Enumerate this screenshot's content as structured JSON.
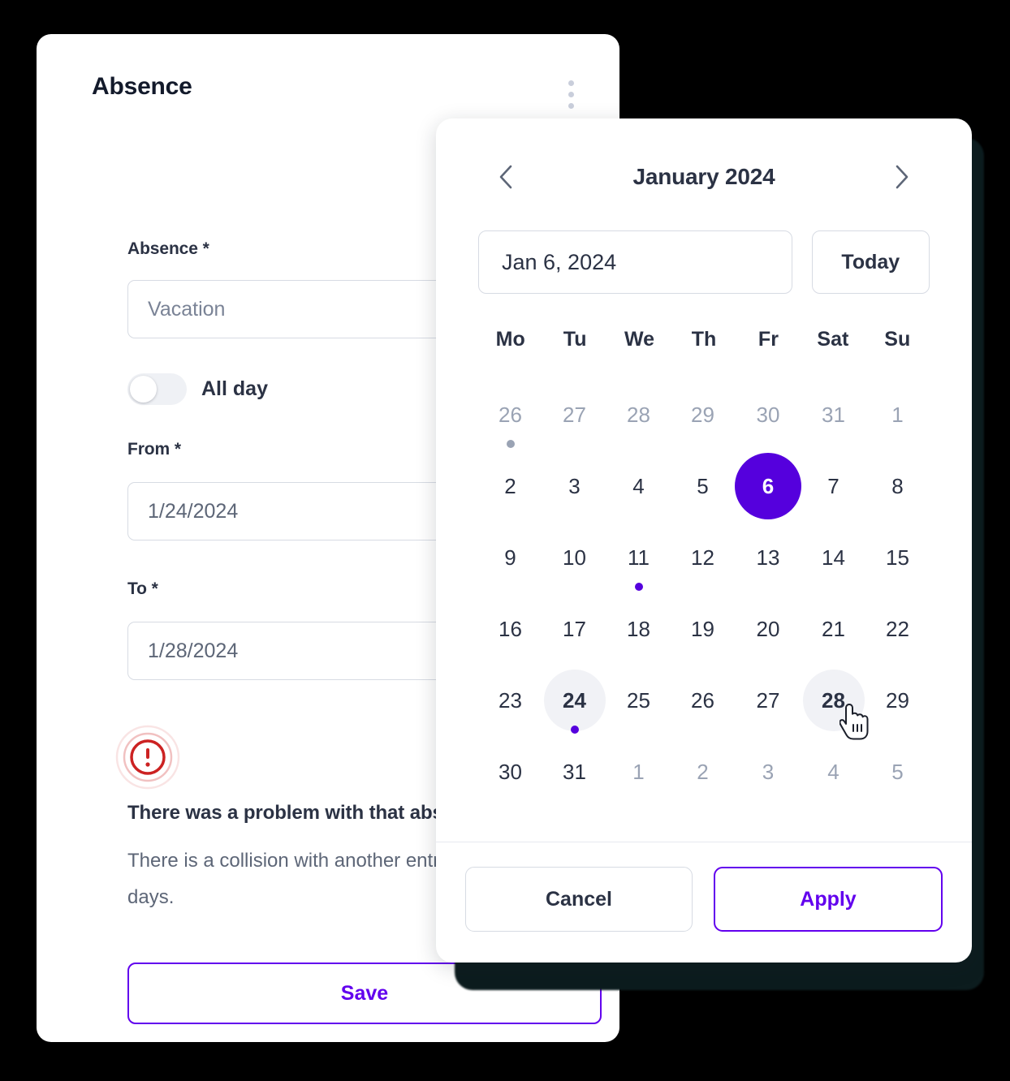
{
  "form": {
    "title": "Absence",
    "menu_icon": "kebab-menu-icon",
    "fields": {
      "absence": {
        "label": "Absence *",
        "value": "Vacation",
        "placeholder": "Vacation"
      },
      "all_day": {
        "label": "All day",
        "enabled": false
      },
      "from": {
        "label": "From *",
        "value": "1/24/2024",
        "placeholder": "1/24/2024"
      },
      "to": {
        "label": "To *",
        "value": "1/28/2024",
        "placeholder": "1/28/2024"
      }
    },
    "error": {
      "icon": "error-circle-icon",
      "title": "There was a problem with that absence",
      "body": "There is a collision with another entry on one of the days.",
      "color": "#cc2222"
    },
    "save_label": "Save"
  },
  "calendar": {
    "prev_icon": "chevron-left-icon",
    "next_icon": "chevron-right-icon",
    "month_label": "January 2024",
    "date_value": "Jan 6, 2024",
    "today_label": "Today",
    "weekdays": [
      "Mo",
      "Tu",
      "We",
      "Th",
      "Fr",
      "Sat",
      "Su"
    ],
    "accent_color": "#5500dd",
    "days": [
      {
        "n": "26",
        "muted": true,
        "dot": "gray"
      },
      {
        "n": "27",
        "muted": true
      },
      {
        "n": "28",
        "muted": true
      },
      {
        "n": "29",
        "muted": true
      },
      {
        "n": "30",
        "muted": true
      },
      {
        "n": "31",
        "muted": true
      },
      {
        "n": "1",
        "muted": true
      },
      {
        "n": "2"
      },
      {
        "n": "3"
      },
      {
        "n": "4"
      },
      {
        "n": "5"
      },
      {
        "n": "6",
        "selected": true
      },
      {
        "n": "7"
      },
      {
        "n": "8"
      },
      {
        "n": "9"
      },
      {
        "n": "10"
      },
      {
        "n": "11",
        "dot": "purple"
      },
      {
        "n": "12"
      },
      {
        "n": "13"
      },
      {
        "n": "14"
      },
      {
        "n": "15"
      },
      {
        "n": "16"
      },
      {
        "n": "17"
      },
      {
        "n": "18"
      },
      {
        "n": "19"
      },
      {
        "n": "20"
      },
      {
        "n": "21"
      },
      {
        "n": "22"
      },
      {
        "n": "23"
      },
      {
        "n": "24",
        "highlight": true,
        "dot": "purple"
      },
      {
        "n": "25"
      },
      {
        "n": "26"
      },
      {
        "n": "27"
      },
      {
        "n": "28",
        "highlight": true
      },
      {
        "n": "29"
      },
      {
        "n": "30"
      },
      {
        "n": "31"
      },
      {
        "n": "1",
        "muted": true
      },
      {
        "n": "2",
        "muted": true
      },
      {
        "n": "3",
        "muted": true
      },
      {
        "n": "4",
        "muted": true
      },
      {
        "n": "5",
        "muted": true
      }
    ],
    "cancel_label": "Cancel",
    "apply_label": "Apply"
  },
  "cursor": {
    "icon": "hand-pointer-cursor"
  }
}
